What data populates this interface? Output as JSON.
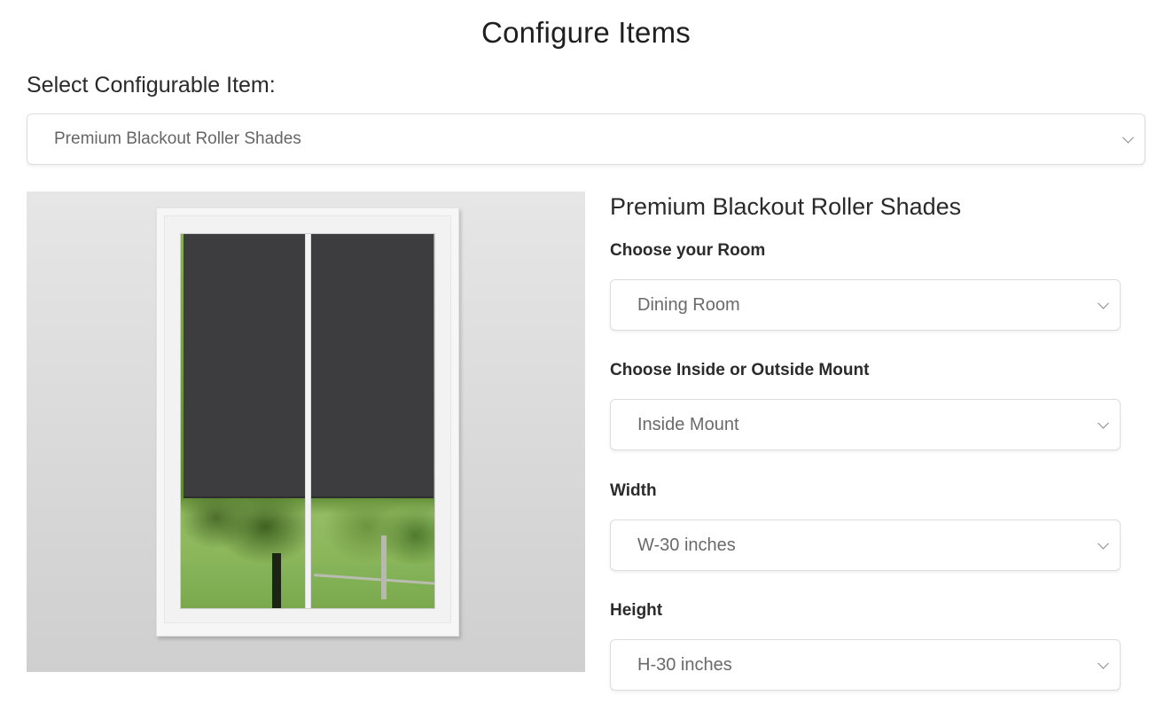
{
  "page": {
    "title": "Configure Items"
  },
  "item_selector": {
    "label": "Select Configurable Item:",
    "selected": "Premium Blackout Roller Shades"
  },
  "product": {
    "image_alt": "Window with dark gray blackout roller shades partially lowered, trees visible outside",
    "shade_color": "#3d3d3f",
    "title": "Premium Blackout Roller Shades",
    "options": [
      {
        "label": "Choose your Room",
        "selected": "Dining Room"
      },
      {
        "label": "Choose Inside or Outside Mount",
        "selected": "Inside Mount"
      },
      {
        "label": "Width",
        "selected": "W-30 inches"
      },
      {
        "label": "Height",
        "selected": "H-30 inches"
      }
    ]
  },
  "icons": {
    "dropdown": "chevron-down-icon"
  }
}
